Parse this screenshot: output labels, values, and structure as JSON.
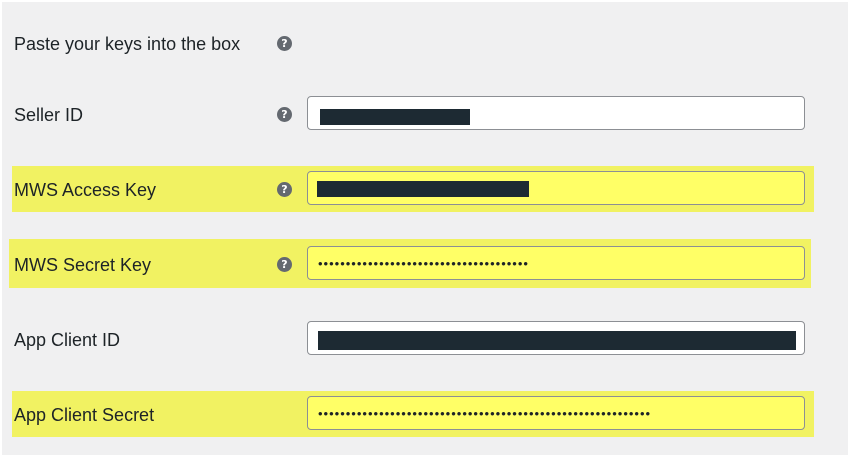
{
  "form": {
    "intro_label": "Paste your keys into the box",
    "fields": [
      {
        "label": "Seller ID",
        "value": "",
        "help": "?"
      },
      {
        "label": "MWS Access Key",
        "value": "",
        "help": "?"
      },
      {
        "label": "MWS Secret Key",
        "value": "••••••••••••••••••••••••••••••••••••••",
        "help": "?"
      },
      {
        "label": "App Client ID",
        "value": ""
      },
      {
        "label": "App Client Secret",
        "value": "••••••••••••••••••••••••••••••••••••••••••••••••••••••••••••"
      }
    ]
  },
  "intro_help": "?",
  "colors": {
    "highlight": "#f1f262",
    "field_highlight": "#ffff66",
    "panel_bg": "#f0f0f1",
    "help_icon": "#646970",
    "redaction": "#1d2a33"
  },
  "icons": {
    "help": "question-mark-circle-icon"
  }
}
